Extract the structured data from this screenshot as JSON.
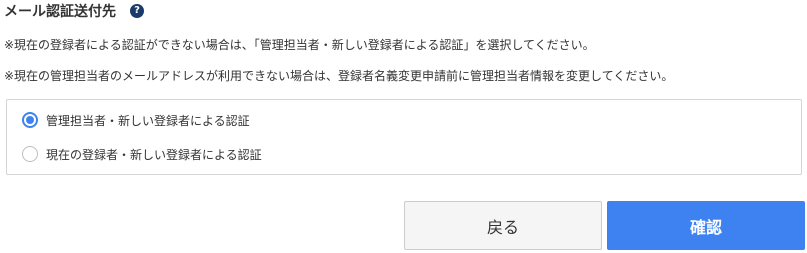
{
  "section": {
    "title": "メール認証送付先",
    "help_icon": "question-circle-icon",
    "help_glyph": "?"
  },
  "notes": [
    "※現在の登録者による認証ができない場合は、「管理担当者・新しい登録者による認証」を選択してください。",
    "※現在の管理担当者のメールアドレスが利用できない場合は、登録者名義変更申請前に管理担当者情報を変更してください。"
  ],
  "options": [
    {
      "label": "管理担当者・新しい登録者による認証",
      "selected": true
    },
    {
      "label": "現在の登録者・新しい登録者による認証",
      "selected": false
    }
  ],
  "buttons": {
    "back_label": "戻る",
    "confirm_label": "確認"
  },
  "colors": {
    "accent": "#3d82f0",
    "help_icon": "#1a3a6b",
    "back_button_bg": "#f5f5f5",
    "border": "#d4d4d4"
  }
}
